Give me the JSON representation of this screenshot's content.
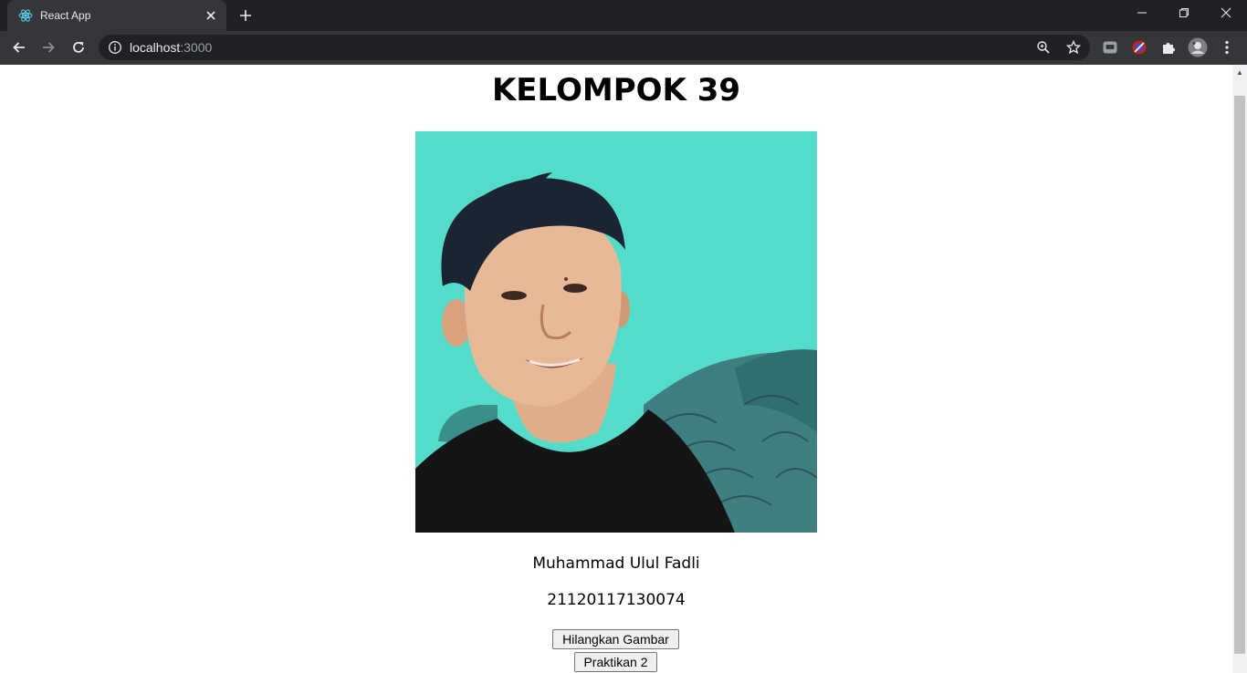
{
  "browser": {
    "tab_title": "React App",
    "url_host": "localhost",
    "url_port": ":3000",
    "icons": [
      "react-favicon-icon",
      "close-icon",
      "plus-icon",
      "minimize-icon",
      "restore-icon",
      "window-close-icon",
      "back-arrow-icon",
      "forward-arrow-icon",
      "reload-icon",
      "info-icon",
      "zoom-icon",
      "star-icon",
      "chat-extension-icon",
      "blocker-extension-icon",
      "puzzle-icon",
      "profile-avatar",
      "kebab-menu-icon"
    ]
  },
  "page": {
    "heading": "KELOMPOK 39",
    "name": "Muhammad Ulul Fadli",
    "nim": "21120117130074",
    "buttons": {
      "hide_image": "Hilangkan Gambar",
      "praktikan": "Praktikan 2"
    },
    "colors": {
      "photo_background": "#4fd9c6",
      "shirt": "#151515"
    }
  }
}
